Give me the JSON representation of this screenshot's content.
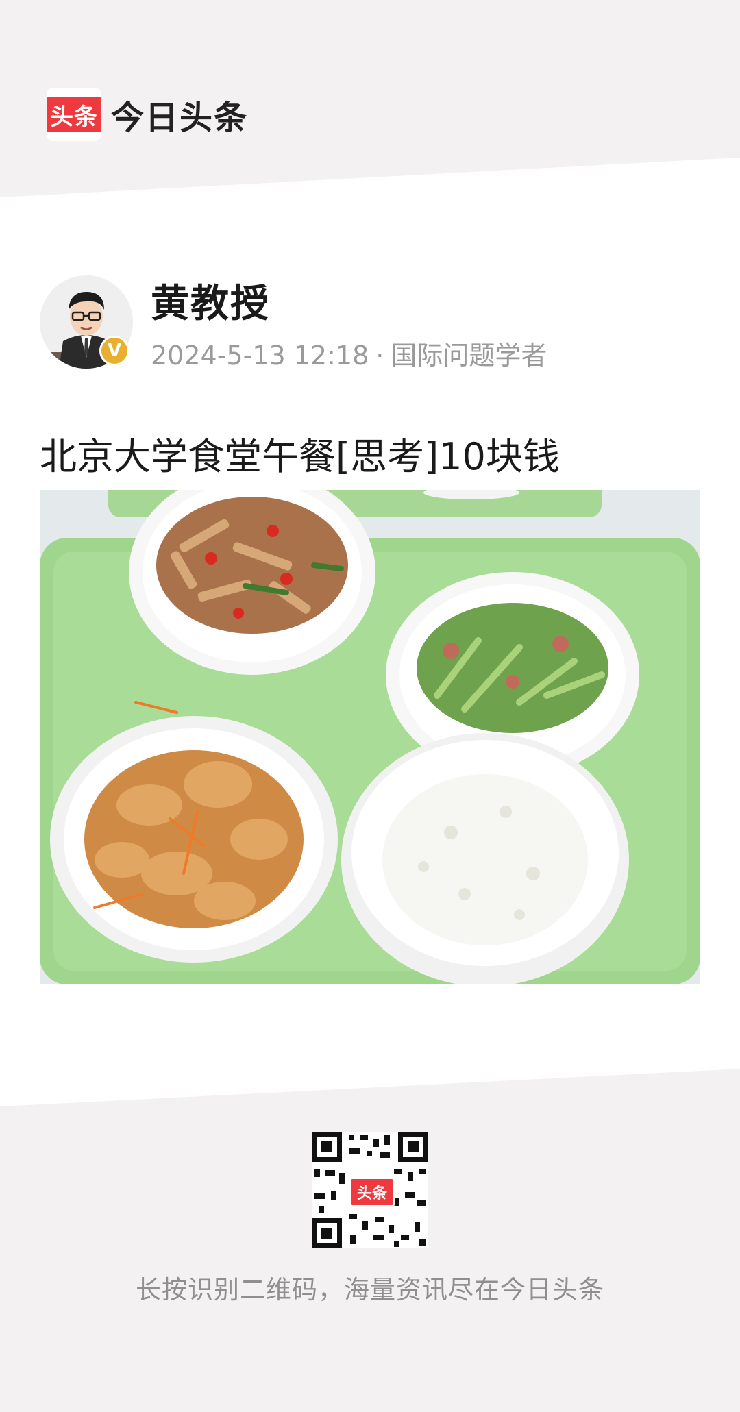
{
  "brand": {
    "logo_text": "头条",
    "name": "今日头条"
  },
  "author": {
    "name": "黄教授",
    "badge": "V",
    "date": "2024-5-13 12:18",
    "separator": "·",
    "role": "国际问题学者"
  },
  "post": {
    "title": "北京大学食堂午餐[思考]10块钱"
  },
  "footer": {
    "qr_badge": "头条",
    "text": "长按识别二维码，海量资讯尽在今日头条"
  },
  "colors": {
    "brand_red": "#ee3a3f",
    "badge_gold": "#e9b02f",
    "tray_green": "#9fd58d"
  },
  "icons": {
    "avatar": "cartoon-professor-avatar",
    "verified": "verified-v-badge",
    "qr": "qr-code"
  }
}
